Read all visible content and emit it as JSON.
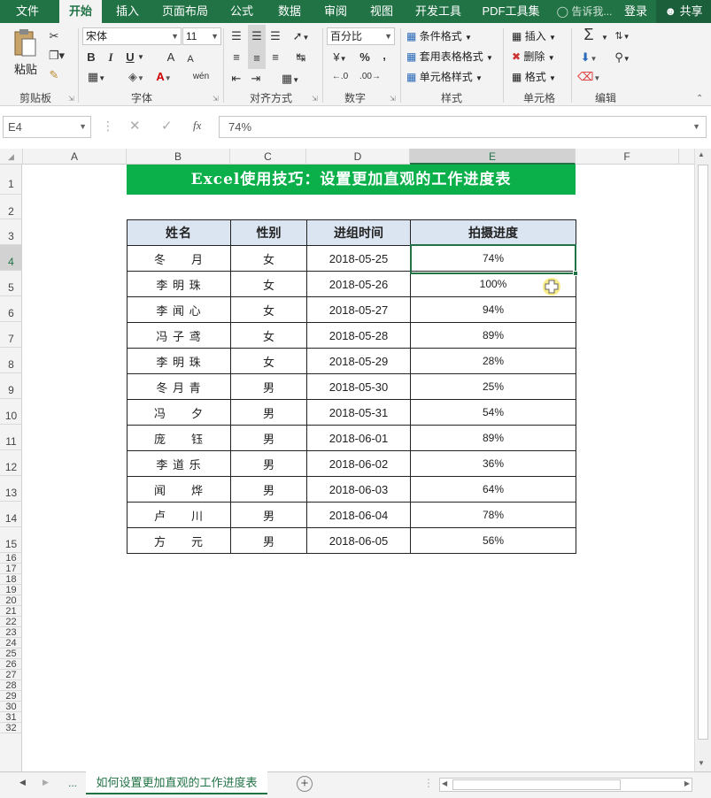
{
  "menu": [
    "文件",
    "开始",
    "插入",
    "页面布局",
    "公式",
    "数据",
    "审阅",
    "视图",
    "开发工具",
    "PDF工具集"
  ],
  "menu_active": "开始",
  "tell_me": "告诉我...",
  "login": "登录",
  "share": "共享",
  "ribbon": {
    "paste": "粘贴",
    "font_name": "宋体",
    "font_size": "11",
    "bold": "B",
    "italic": "I",
    "underline": "U",
    "grow_font": "A",
    "shrink_font": "A",
    "wen": "wén",
    "number_format": "百分比",
    "percent": "%",
    "comma": ",",
    "cond_format": "条件格式",
    "table_format": "套用表格格式",
    "cell_style": "单元格样式",
    "insert": "插入",
    "delete": "删除",
    "format": "格式",
    "sigma": "Σ",
    "groups": {
      "clipboard": "剪贴板",
      "font": "字体",
      "alignment": "对齐方式",
      "number": "数字",
      "styles": "样式",
      "cells": "单元格",
      "editing": "编辑"
    }
  },
  "formula_bar": {
    "name_box": "E4",
    "fx": "fx",
    "value": "74%"
  },
  "columns": [
    "A",
    "B",
    "C",
    "D",
    "E",
    "F"
  ],
  "rows": [
    "1",
    "2",
    "3",
    "4",
    "5",
    "6",
    "7",
    "8",
    "9",
    "10",
    "11",
    "12",
    "13",
    "14",
    "15",
    "16",
    "17",
    "18",
    "19",
    "20",
    "21",
    "22",
    "23",
    "24",
    "25",
    "26",
    "27",
    "28",
    "29",
    "30",
    "31",
    "32"
  ],
  "title_banner": "Excel使用技巧：设置更加直观的工作进度表",
  "table": {
    "headers": [
      "姓名",
      "性别",
      "进组时间",
      "拍摄进度"
    ],
    "rows": [
      [
        "冬　　月",
        "女",
        "2018-05-25",
        "74%"
      ],
      [
        "李 明 珠",
        "女",
        "2018-05-26",
        "100%"
      ],
      [
        "李 闻 心",
        "女",
        "2018-05-27",
        "94%"
      ],
      [
        "冯 子 鸢",
        "女",
        "2018-05-28",
        "89%"
      ],
      [
        "李 明 珠",
        "女",
        "2018-05-29",
        "28%"
      ],
      [
        "冬 月 青",
        "男",
        "2018-05-30",
        "25%"
      ],
      [
        "冯　　夕",
        "男",
        "2018-05-31",
        "54%"
      ],
      [
        "庞　　钰",
        "男",
        "2018-06-01",
        "89%"
      ],
      [
        "李 道 乐",
        "男",
        "2018-06-02",
        "36%"
      ],
      [
        "闻　　烨",
        "男",
        "2018-06-03",
        "64%"
      ],
      [
        "卢　　川",
        "男",
        "2018-06-04",
        "78%"
      ],
      [
        "方　　元",
        "男",
        "2018-06-05",
        "56%"
      ]
    ]
  },
  "sheet_tab": "如何设置更加直观的工作进度表",
  "sheet_nav_more": "...",
  "colors": {
    "accent": "#217346",
    "banner": "#0bb04b",
    "header_fill": "#dbe5f1"
  }
}
